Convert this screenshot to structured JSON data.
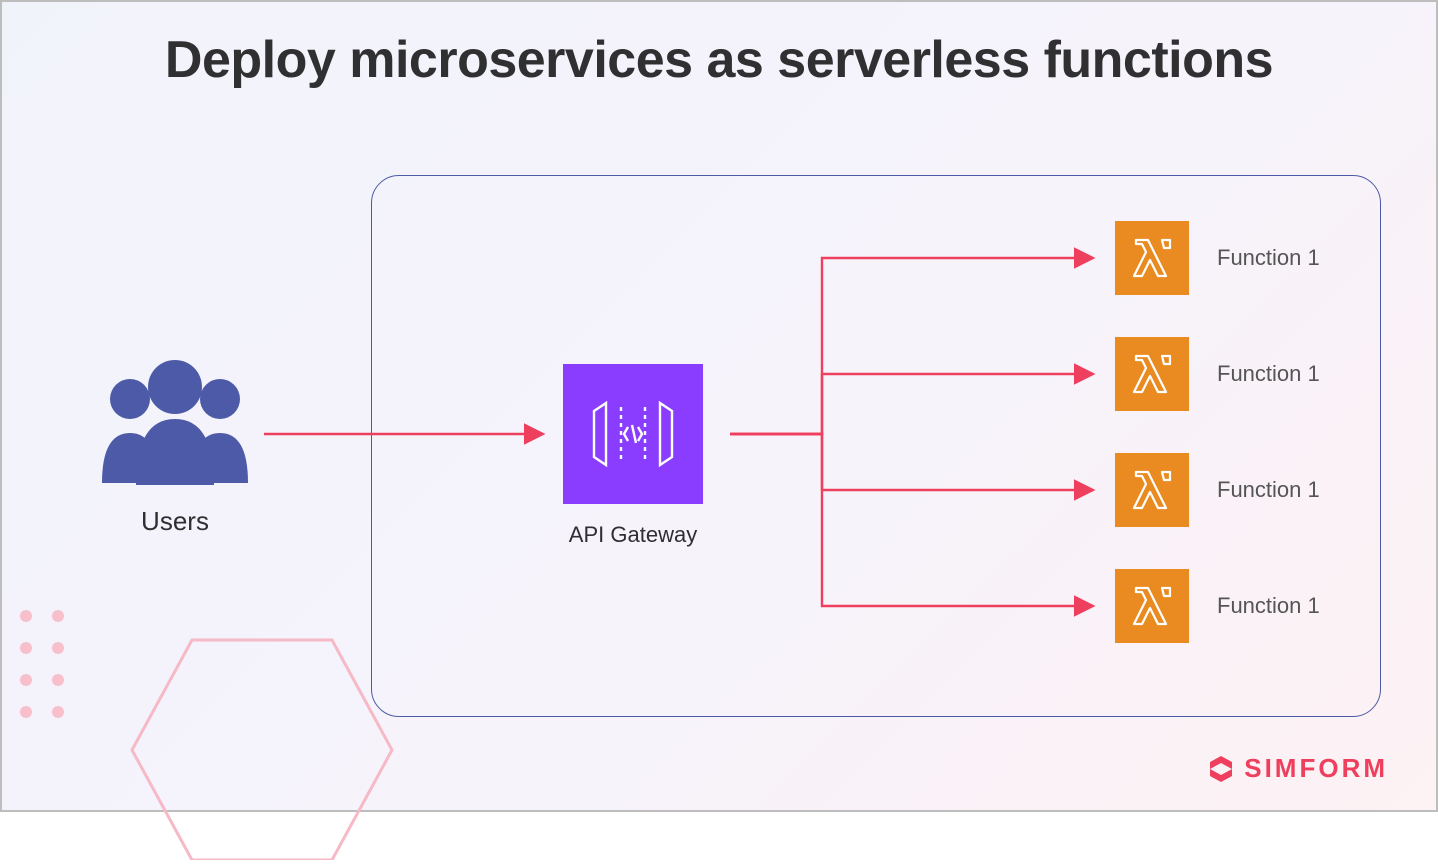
{
  "title": "Deploy microservices as serverless functions",
  "users_label": "Users",
  "gateway_label": "API Gateway",
  "functions": [
    {
      "label": "Function 1"
    },
    {
      "label": "Function 1"
    },
    {
      "label": "Function 1"
    },
    {
      "label": "Function 1"
    }
  ],
  "brand": "SIMFORM",
  "colors": {
    "arrow": "#ef3f5e",
    "users_icon": "#4d5aa7",
    "gateway_tile": "#8b3dff",
    "lambda_tile": "#e98b21",
    "box_border": "#4d5aa7"
  }
}
